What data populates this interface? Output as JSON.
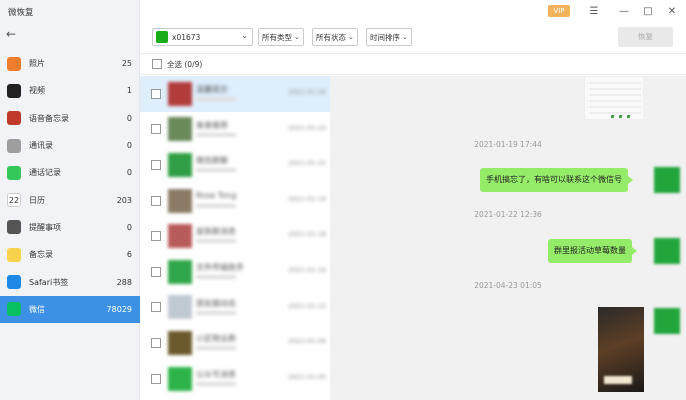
{
  "app": {
    "title": "微恢复"
  },
  "sidebar": {
    "items": [
      {
        "label": "照片",
        "count": "25",
        "color": "#f07c2d"
      },
      {
        "label": "视频",
        "count": "1",
        "color": "#222222"
      },
      {
        "label": "语音备忘录",
        "count": "0",
        "color": "#c0392b"
      },
      {
        "label": "通讯录",
        "count": "0",
        "color": "#9e9e9e"
      },
      {
        "label": "通话记录",
        "count": "0",
        "color": "#34c759"
      },
      {
        "label": "日历",
        "count": "203",
        "color": "#ffffff"
      },
      {
        "label": "提醒事项",
        "count": "0",
        "color": "#555555"
      },
      {
        "label": "备忘录",
        "count": "6",
        "color": "#f8d24c"
      },
      {
        "label": "Safari书签",
        "count": "288",
        "color": "#1e88e5"
      },
      {
        "label": "微信",
        "count": "78029",
        "color": "#07c160"
      }
    ],
    "calendar_day": "22",
    "active_index": 9
  },
  "topbar": {
    "vip": "VIP"
  },
  "toolbar": {
    "account": "x01673",
    "filters": [
      "所有类型",
      "所有状态",
      "时间排序"
    ],
    "recover_label": "恢复"
  },
  "select_all": "全选 (0/9)",
  "contacts": [
    {
      "name": "温馨提示",
      "time": "2021-01-26",
      "color": "#b23b3b",
      "selected": true
    },
    {
      "name": "美食推荐",
      "time": "2021-01-23",
      "color": "#6a8a5a",
      "selected": false
    },
    {
      "name": "微信群聊",
      "time": "2021-01-22",
      "color": "#2f9e44",
      "selected": false
    },
    {
      "name": "Rose Tong",
      "time": "2021-01-19",
      "color": "#8a7a66",
      "selected": false
    },
    {
      "name": "家族群消息",
      "time": "2021-01-18",
      "color": "#b85b5b",
      "selected": false
    },
    {
      "name": "文件传输助手",
      "time": "2021-01-16",
      "color": "#30a74a",
      "selected": false
    },
    {
      "name": "朋友圈动态",
      "time": "2021-01-12",
      "color": "#bfc9d2",
      "selected": false
    },
    {
      "name": "小区物业群",
      "time": "2021-01-09",
      "color": "#6b5a2c",
      "selected": false
    },
    {
      "name": "公众号消息",
      "time": "2021-01-05",
      "color": "#2eb34a",
      "selected": false
    }
  ],
  "chat": {
    "stamps": [
      "2021-01-19 17:44",
      "2021-01-22 12:36",
      "2021-04-23 01:05"
    ],
    "messages": [
      "手机搞忘了，有啥可以联系这个微信号",
      "群里报活动草莓数量"
    ]
  }
}
